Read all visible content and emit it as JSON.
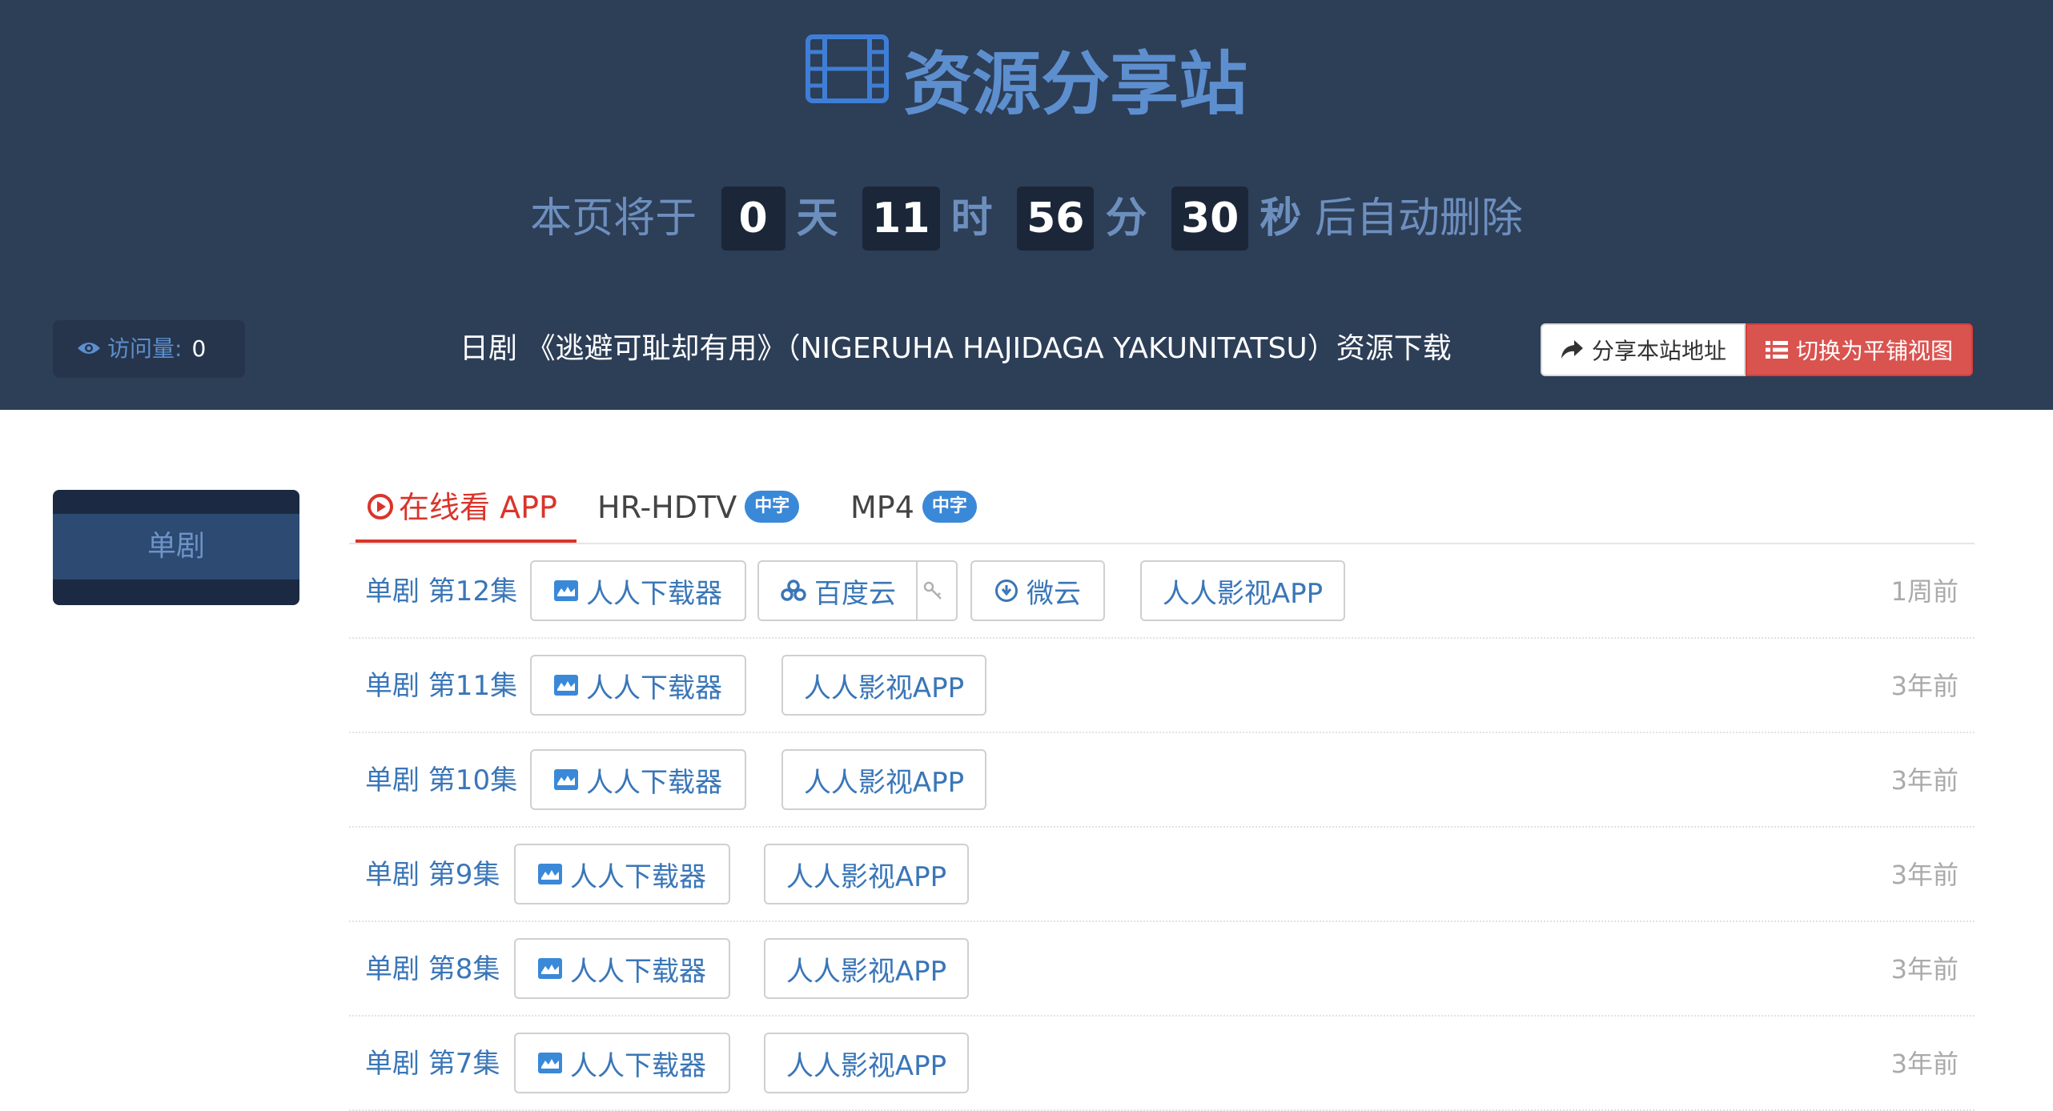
{
  "header": {
    "site_title": "资源分享站",
    "countdown": {
      "prefix": "本页将于",
      "days": "0",
      "days_unit": "天",
      "hours": "11",
      "hours_unit": "时",
      "minutes": "56",
      "minutes_unit": "分",
      "seconds": "30",
      "seconds_unit": "秒",
      "suffix": "后自动删除"
    },
    "visits_label": "访问量:",
    "visits_value": "0",
    "page_heading": "日剧 《逃避可耻却有用》（NIGERUHA HAJIDAGA YAKUNITATSU）资源下载",
    "share_button": "分享本站地址",
    "tile_view_button": "切换为平铺视图"
  },
  "sidebar": {
    "items": [
      {
        "label": "单剧"
      }
    ]
  },
  "tabs": [
    {
      "label": "在线看 APP",
      "badge": ""
    },
    {
      "label": "HR-HDTV",
      "badge": "中字"
    },
    {
      "label": "MP4",
      "badge": "中字"
    }
  ],
  "episodes": [
    {
      "label": "单剧 第12集",
      "links": [
        "人人下载器",
        "百度云",
        "微云",
        "人人影视APP"
      ],
      "time": "1周前"
    },
    {
      "label": "单剧 第11集",
      "links": [
        "人人下载器",
        "人人影视APP"
      ],
      "time": "3年前"
    },
    {
      "label": "单剧 第10集",
      "links": [
        "人人下载器",
        "人人影视APP"
      ],
      "time": "3年前"
    },
    {
      "label": "单剧 第9集",
      "links": [
        "人人下载器",
        "人人影视APP"
      ],
      "time": "3年前"
    },
    {
      "label": "单剧 第8集",
      "links": [
        "人人下载器",
        "人人影视APP"
      ],
      "time": "3年前"
    },
    {
      "label": "单剧 第7集",
      "links": [
        "人人下载器",
        "人人影视APP"
      ],
      "time": "3年前"
    }
  ],
  "colors": {
    "header_bg": "#2d3e57",
    "accent_blue": "#3a76b8",
    "danger_red": "#d9534f",
    "active_tab": "#d9352b"
  }
}
